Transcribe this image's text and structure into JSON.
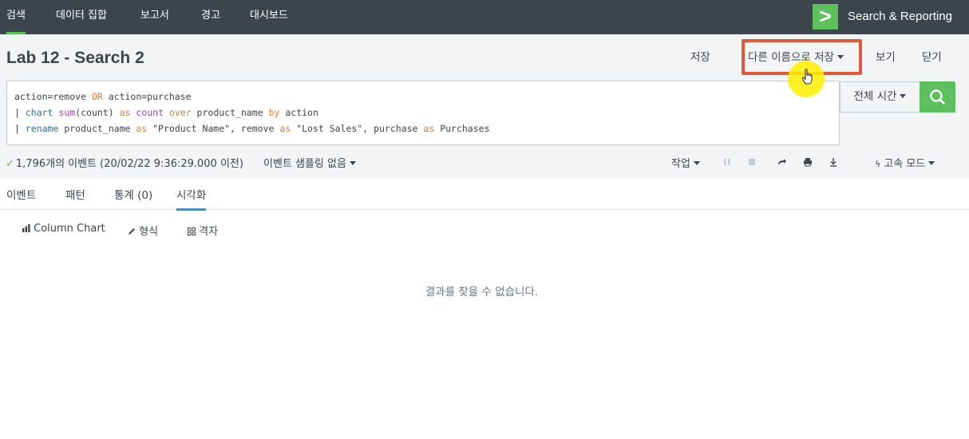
{
  "topnav": {
    "items": [
      "검색",
      "데이터 집합",
      "보고서",
      "경고",
      "대시보드"
    ],
    "app_name": "Search & Reporting",
    "logo_glyph": ">",
    "accent": "#5cc05c"
  },
  "header": {
    "title": "Lab 12 - Search 2",
    "save_label": "저장",
    "save_as_label": "다른 이름으로 저장",
    "view_label": "보기",
    "close_label": "닫기"
  },
  "search": {
    "line1": {
      "a": "action=remove ",
      "b": "OR",
      "c": " action=purchase"
    },
    "line2": {
      "pipe": "| ",
      "cmd": "chart",
      "sp": " ",
      "fn": "sum",
      "args": "(count) ",
      "as": "as",
      "cnt": " count ",
      "over": "over",
      "pn": " product_name ",
      "by": "by",
      "act": " action"
    },
    "line3": {
      "pipe": "| ",
      "cmd": "rename",
      "pn": " product_name ",
      "as1": "as",
      "s1": " \"Product Name\", remove ",
      "as2": "as",
      "s2": " \"Lost Sales\", purchase ",
      "as3": "as",
      "s3": " Purchases"
    },
    "time_range": "전체 시간",
    "search_icon": "search-icon"
  },
  "status": {
    "events": "1,796개의 이벤트 (20/02/22 9:36:29.000 이전)",
    "sampling": "이벤트 샘플링 없음",
    "job": "작업",
    "mode": "고속 모드"
  },
  "tabs": [
    "이벤트",
    "패턴",
    "통계 (0)",
    "시각화"
  ],
  "viz": {
    "chart_type": "Column Chart",
    "format": "형식",
    "trellis": "격자"
  },
  "empty_message": "결과를 찾을 수 없습니다.",
  "colors": {
    "highlight_border": "#e0593a",
    "search_button": "#5cc05c",
    "active_tab": "#1a9ce0"
  }
}
